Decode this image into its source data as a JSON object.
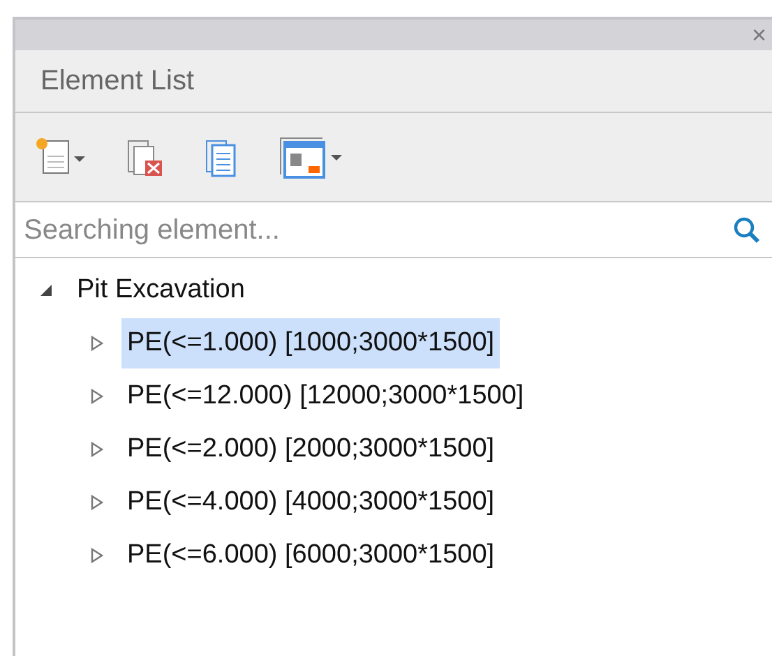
{
  "panel": {
    "title": "Element List",
    "close": "×"
  },
  "search": {
    "placeholder": "Searching element..."
  },
  "tree": [
    {
      "label": "Pit Excavation",
      "expanded": true,
      "selected": false,
      "children": [
        {
          "label": "PE(<=1.000) [1000;3000*1500]",
          "expanded": false,
          "selected": true
        },
        {
          "label": "PE(<=12.000) [12000;3000*1500]",
          "expanded": false,
          "selected": false
        },
        {
          "label": "PE(<=2.000) [2000;3000*1500]",
          "expanded": false,
          "selected": false
        },
        {
          "label": "PE(<=4.000) [4000;3000*1500]",
          "expanded": false,
          "selected": false
        },
        {
          "label": "PE(<=6.000) [6000;3000*1500]",
          "expanded": false,
          "selected": false
        }
      ]
    }
  ]
}
